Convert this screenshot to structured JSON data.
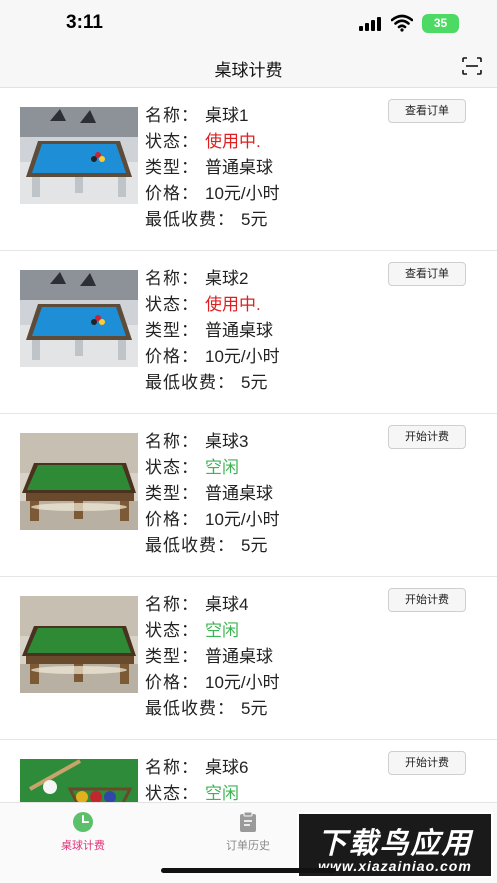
{
  "status_bar": {
    "time": "3:11",
    "battery": "35"
  },
  "nav": {
    "title": "桌球计费",
    "scan_icon": "scan-icon"
  },
  "colors": {
    "accent": "#e0337a",
    "busy": "#e02020",
    "idle": "#3cb451"
  },
  "tables": [
    {
      "name_label": "名称：",
      "name": "桌球1",
      "status_label": "状态：",
      "status": "使用中.",
      "status_kind": "busy",
      "type_label": "类型：",
      "type": "普通桌球",
      "price_label": "价格：",
      "price": "10元/小时",
      "min_label": "最低收费：",
      "min": "5元",
      "button": "查看订单",
      "image": "blue-pool-table"
    },
    {
      "name_label": "名称：",
      "name": "桌球2",
      "status_label": "状态：",
      "status": "使用中.",
      "status_kind": "busy",
      "type_label": "类型：",
      "type": "普通桌球",
      "price_label": "价格：",
      "price": "10元/小时",
      "min_label": "最低收费：",
      "min": "5元",
      "button": "查看订单",
      "image": "blue-pool-table"
    },
    {
      "name_label": "名称：",
      "name": "桌球3",
      "status_label": "状态：",
      "status": "空闲",
      "status_kind": "idle",
      "type_label": "类型：",
      "type": "普通桌球",
      "price_label": "价格：",
      "price": "10元/小时",
      "min_label": "最低收费：",
      "min": "5元",
      "button": "开始计费",
      "image": "green-snooker-table"
    },
    {
      "name_label": "名称：",
      "name": "桌球4",
      "status_label": "状态：",
      "status": "空闲",
      "status_kind": "idle",
      "type_label": "类型：",
      "type": "普通桌球",
      "price_label": "价格：",
      "price": "10元/小时",
      "min_label": "最低收费：",
      "min": "5元",
      "button": "开始计费",
      "image": "green-snooker-table"
    },
    {
      "name_label": "名称：",
      "name": "桌球6",
      "status_label": "状态：",
      "status": "空闲",
      "status_kind": "idle",
      "button": "开始计费",
      "image": "pool-balls-rack"
    }
  ],
  "tab_bar": {
    "tabs": [
      {
        "label": "桌球计费",
        "icon": "clock-icon",
        "active": true
      },
      {
        "label": "订单历史",
        "icon": "clipboard-icon",
        "active": false
      },
      {
        "label": "",
        "icon": "gear-icon",
        "active": false
      }
    ]
  },
  "watermark": {
    "top": "下载鸟应用",
    "bottom": "www.xiazainiao.com"
  }
}
